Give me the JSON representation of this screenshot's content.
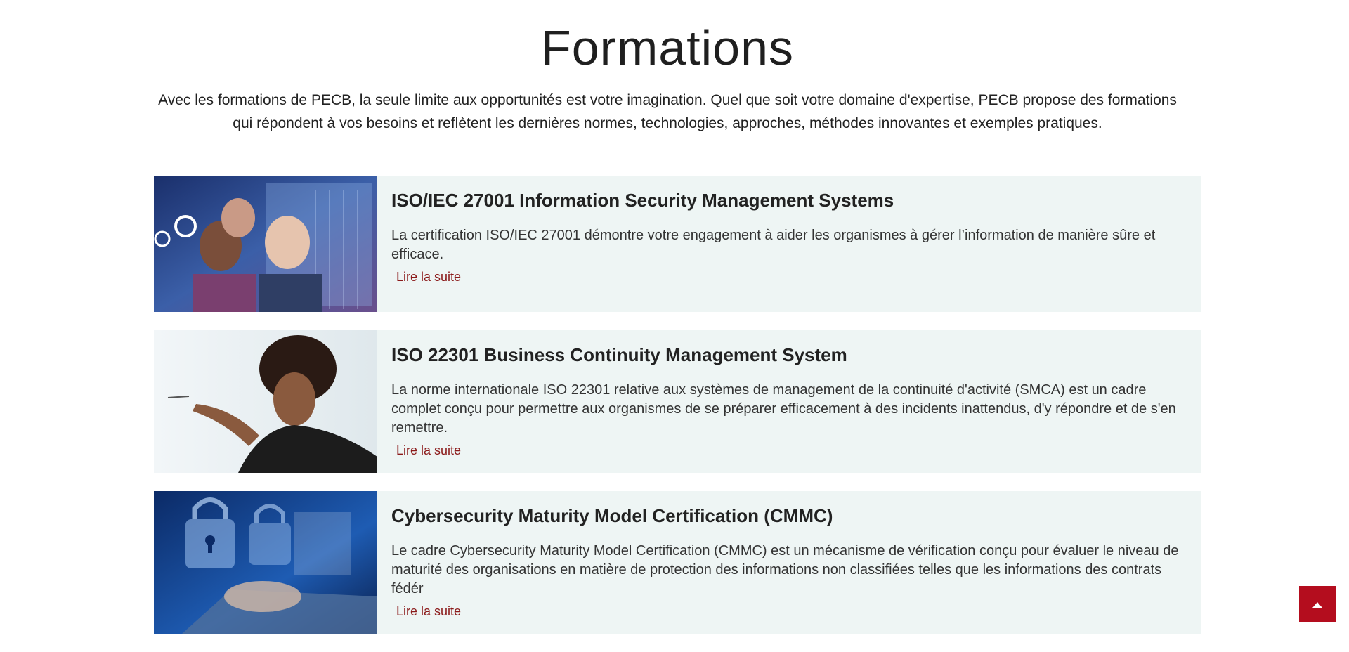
{
  "page": {
    "title": "Formations",
    "intro": "Avec les formations de PECB, la seule limite aux opportunités est votre imagination. Quel que soit votre domaine d'expertise, PECB propose des formations qui répondent à vos besoins et reflètent les dernières normes, technologies, approches, méthodes innovantes et exemples pratiques."
  },
  "courses": [
    {
      "title": "ISO/IEC 27001 Information Security Management Systems",
      "description": "La certification ISO/IEC 27001 démontre votre engagement à aider les organismes à gérer l’information de manière sûre et efficace.",
      "link_label": "Lire la suite",
      "image": "people-looking-at-data-screen"
    },
    {
      "title": "ISO 22301 Business Continuity Management System",
      "description": "La norme internationale ISO 22301 relative aux systèmes de management de la continuité d'activité (SMCA) est un cadre complet conçu pour permettre aux organismes de se préparer efficacement à des incidents inattendus, d'y répondre et de s'en remettre.",
      "link_label": "Lire la suite",
      "image": "woman-writing-on-glass-board"
    },
    {
      "title": "Cybersecurity Maturity Model Certification (CMMC)",
      "description": "Le cadre Cybersecurity Maturity Model Certification (CMMC) est un mécanisme de vérification conçu pour évaluer le niveau de maturité des organisations en matière de protection des informations non classifiées telles que les informations des contrats fédér",
      "link_label": "Lire la suite",
      "image": "padlocks-over-laptop-keyboard"
    }
  ],
  "scroll_top": {
    "icon": "chevron-up-icon"
  },
  "colors": {
    "card_background": "#eef5f4",
    "link": "#8b1a1a",
    "scroll_top_bg": "#b40d1e"
  }
}
